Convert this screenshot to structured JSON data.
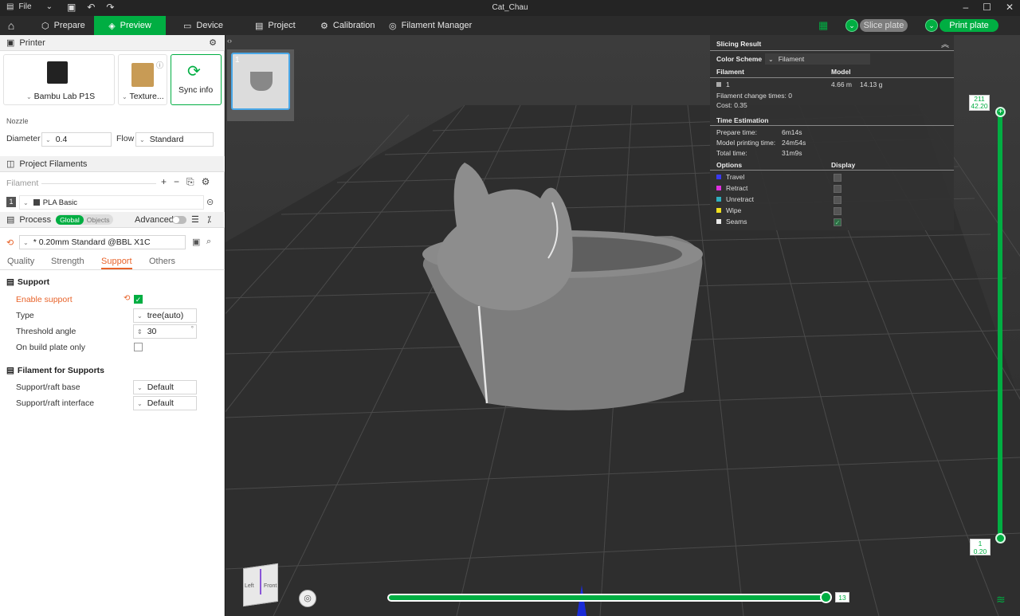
{
  "window": {
    "title": "Cat_Chau",
    "file_menu": "File"
  },
  "topbar": {
    "tabs": [
      "Prepare",
      "Preview",
      "Device",
      "Project",
      "Calibration",
      "Filament Manager"
    ],
    "slice_plate": "Slice plate",
    "print_plate": "Print plate"
  },
  "printer": {
    "section_title": "Printer",
    "printer_name": "Bambu Lab P1S",
    "plate_name": "Texture...",
    "sync_label": "Sync info",
    "nozzle_label": "Nozzle",
    "diameter_label": "Diameter",
    "diameter_value": "0.4",
    "flow_label": "Flow",
    "flow_value": "Standard"
  },
  "filaments": {
    "section_title": "Project Filaments",
    "column_label": "Filament",
    "items": [
      {
        "index": "1",
        "name": "PLA Basic"
      }
    ]
  },
  "process": {
    "section_title": "Process",
    "toggle_global": "Global",
    "toggle_objects": "Objects",
    "advanced_label": "Advanced",
    "preset": "* 0.20mm Standard @BBL X1C",
    "tabs": [
      "Quality",
      "Strength",
      "Support",
      "Others"
    ],
    "active_tab": "Support",
    "support_group": "Support",
    "enable_support_label": "Enable support",
    "enable_support": true,
    "type_label": "Type",
    "type_value": "tree(auto)",
    "threshold_label": "Threshold angle",
    "threshold_value": "30",
    "threshold_unit": "°",
    "build_plate_only_label": "On build plate only",
    "build_plate_only": false,
    "filament_group": "Filament for Supports",
    "raft_base_label": "Support/raft base",
    "raft_base_value": "Default",
    "raft_interface_label": "Support/raft interface",
    "raft_interface_value": "Default"
  },
  "plate_thumb": {
    "number": "1"
  },
  "slicing_result": {
    "title": "Slicing Result",
    "color_scheme_label": "Color Scheme",
    "color_scheme_value": "Filament",
    "col_filament": "Filament",
    "col_model": "Model",
    "filament_row": {
      "index": "1",
      "length": "4.66 m",
      "weight": "14.13 g"
    },
    "change_times": "Filament change times:  0",
    "cost": "Cost:  0.35",
    "time_title": "Time Estimation",
    "prepare_label": "Prepare time:",
    "prepare_value": "6m14s",
    "model_time_label": "Model printing time:",
    "model_time_value": "24m54s",
    "total_label": "Total time:",
    "total_value": "31m9s",
    "options_label": "Options",
    "display_label": "Display",
    "options": [
      {
        "name": "Travel",
        "color": "#3a3af0",
        "checked": false
      },
      {
        "name": "Retract",
        "color": "#e030e0",
        "checked": false
      },
      {
        "name": "Unretract",
        "color": "#30b0c0",
        "checked": false
      },
      {
        "name": "Wipe",
        "color": "#f0e020",
        "checked": false
      },
      {
        "name": "Seams",
        "color": "#eaeaea",
        "checked": true
      }
    ]
  },
  "layer_slider": {
    "top_layer": "211",
    "top_height": "42.20",
    "bottom_layer": "1",
    "bottom_height": "0.20"
  },
  "move_slider": {
    "value": "13"
  },
  "view_cube": {
    "left": "Left",
    "front": "Front"
  },
  "colors": {
    "accent": "#00ae42",
    "orange": "#e8632a"
  }
}
